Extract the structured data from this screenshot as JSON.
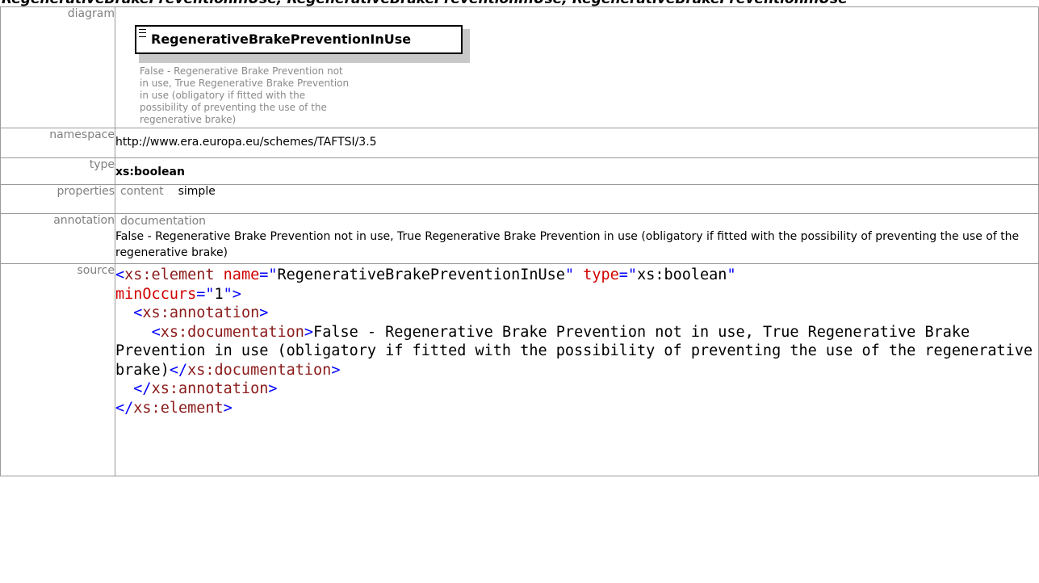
{
  "page": {
    "heading": "RegenerativeBrakePreventionInUse; RegenerativeBrakePreventionInUse; RegenerativeBrakePreventionInUse"
  },
  "labels": {
    "diagram": "diagram",
    "namespace": "namespace",
    "type": "type",
    "properties": "properties",
    "annotation": "annotation",
    "source": "source"
  },
  "diagram": {
    "element_name": "RegenerativeBrakePreventionInUse",
    "documentation": "False - Regenerative Brake Prevention not in use, True Regenerative Brake Prevention in use (obligatory if fitted with the possibility of preventing the use of the regenerative brake)"
  },
  "namespace": "http://www.era.europa.eu/schemes/TAFTSI/3.5",
  "type": "xs:boolean",
  "properties": {
    "key": "content",
    "value": "simple"
  },
  "annotation": {
    "key": "documentation",
    "text": "False - Regenerative Brake Prevention not in use, True Regenerative Brake Prevention in use (obligatory if fitted with the possibility of preventing the use of the regenerative brake)"
  },
  "source": {
    "open_tag": "xs:element",
    "attr_name": "name",
    "attr_name_value": "RegenerativeBrakePreventionInUse",
    "attr_type": "type",
    "attr_type_value": "xs:boolean",
    "attr_min": "minOccurs",
    "attr_min_value": "1",
    "annotation_tag": "xs:annotation",
    "documentation_tag": "xs:documentation",
    "documentation_text": "False - Regenerative Brake Prevention not in use, True Regenerative Brake Prevention in use (obligatory if fitted with the possibility of preventing the use of the regenerative brake)"
  }
}
